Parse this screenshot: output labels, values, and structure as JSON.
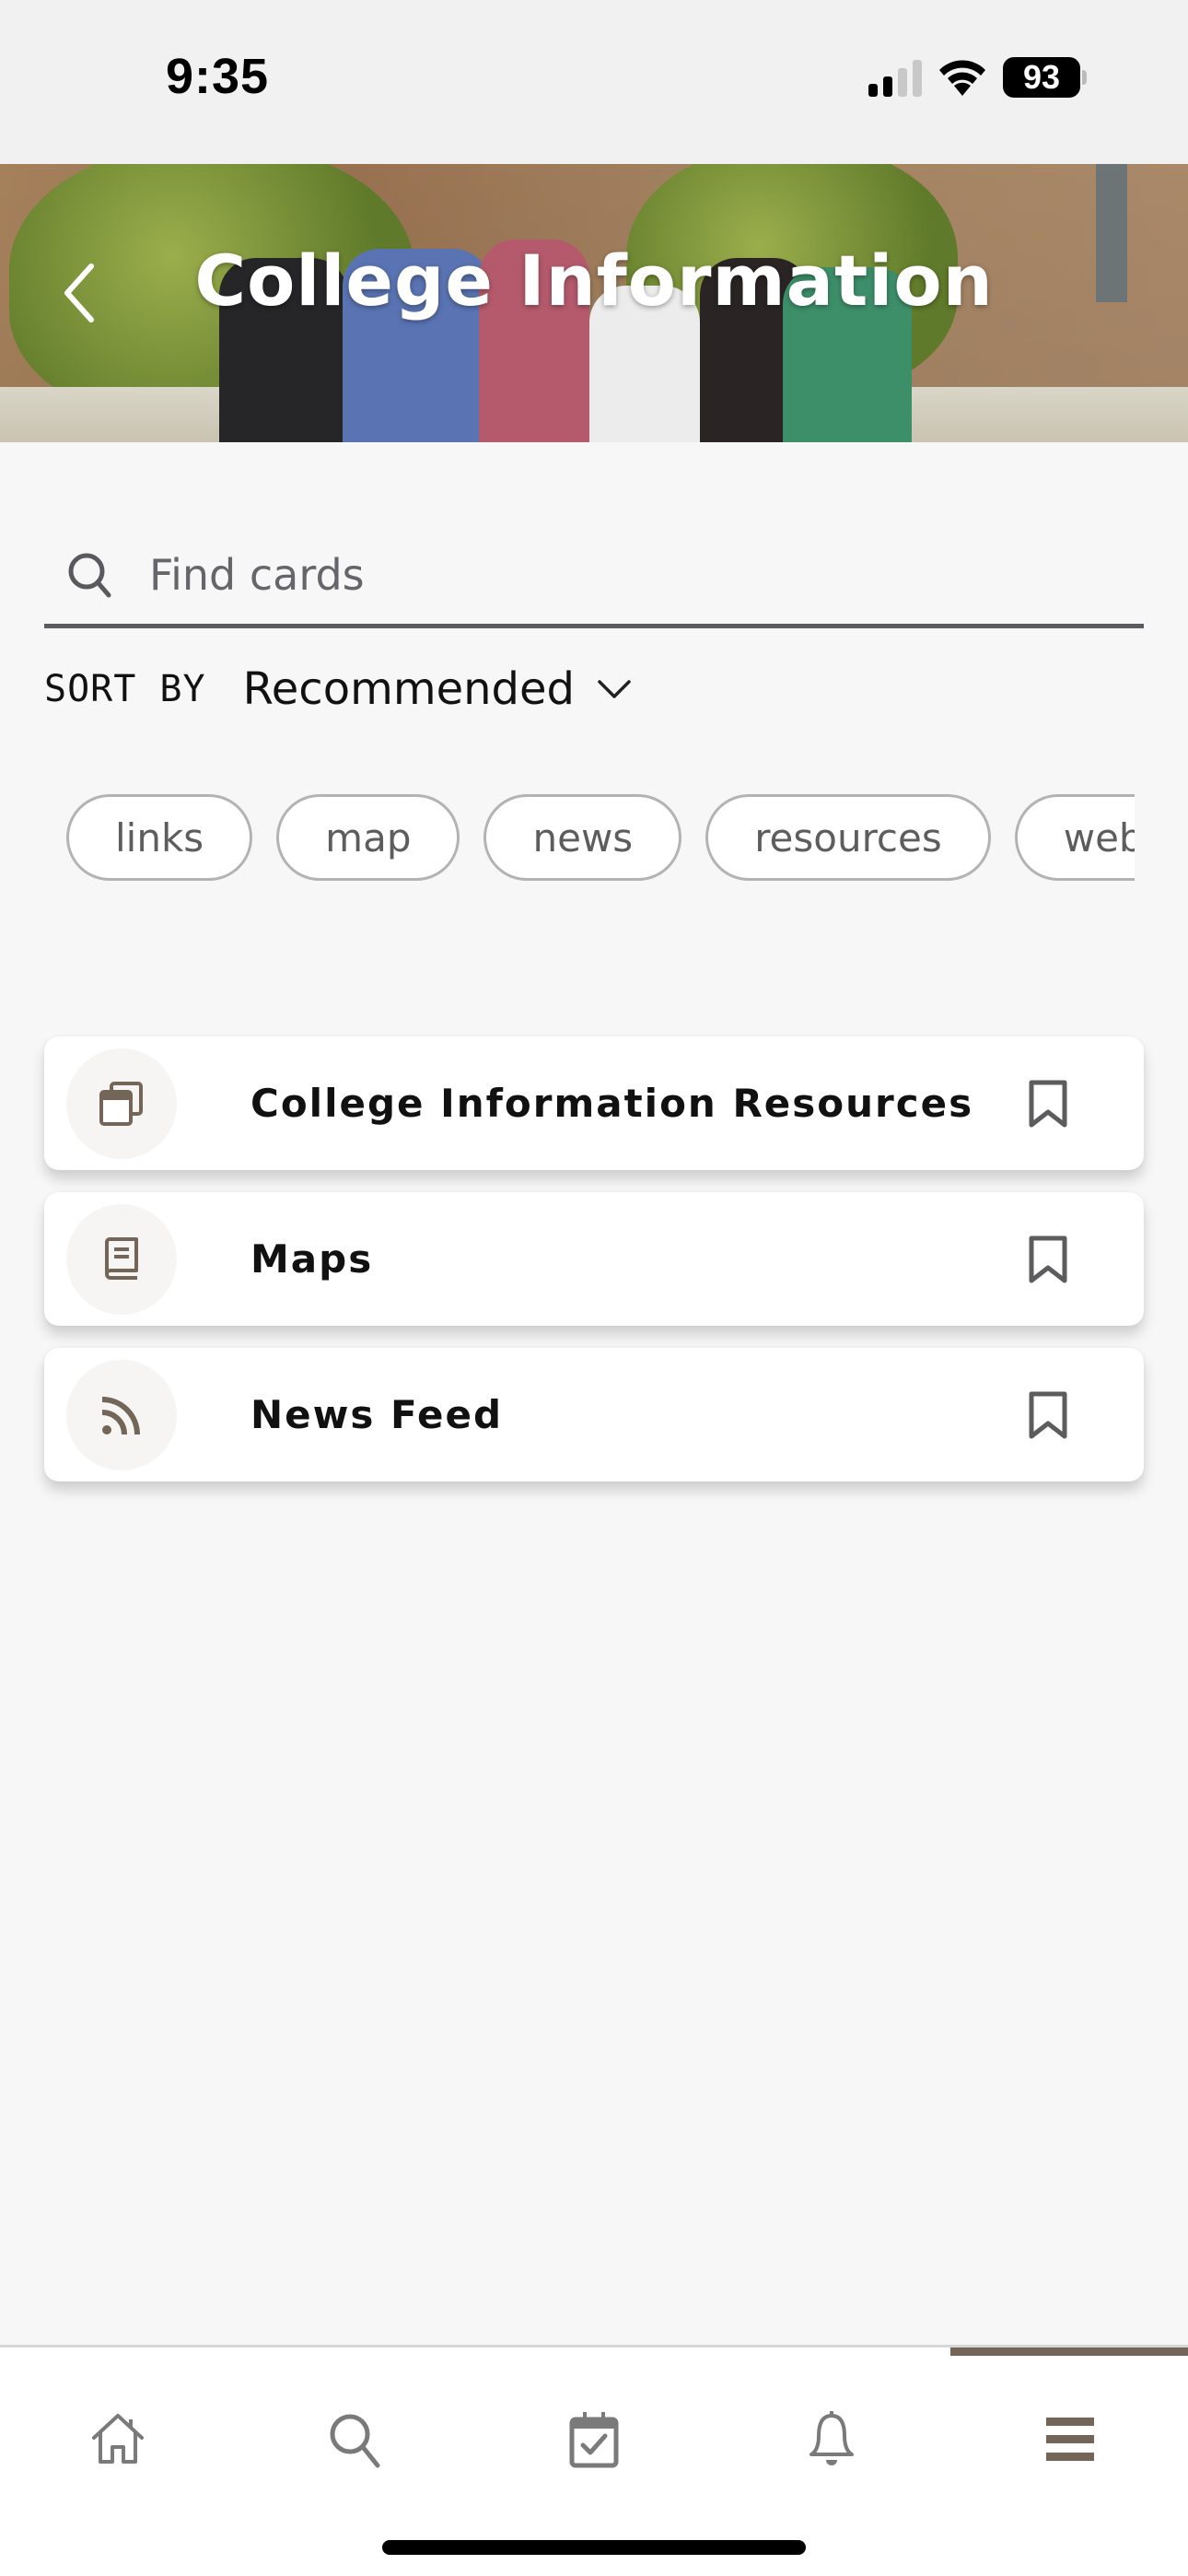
{
  "status_bar": {
    "time": "9:35",
    "battery": "93",
    "signal_bars_active": 2,
    "signal_bars_total": 4
  },
  "header": {
    "title": "College Information",
    "back_icon": "chevron-left-icon"
  },
  "search": {
    "placeholder": "Find cards",
    "value": "",
    "icon": "search-icon"
  },
  "sort": {
    "label": "SORT BY",
    "selected": "Recommended"
  },
  "filters": [
    {
      "label": "links"
    },
    {
      "label": "map"
    },
    {
      "label": "news"
    },
    {
      "label": "resources"
    },
    {
      "label": "web"
    }
  ],
  "cards": [
    {
      "title": "College Information Resources",
      "icon": "windows-icon",
      "bookmarked": false
    },
    {
      "title": "Maps",
      "icon": "book-icon",
      "bookmarked": false
    },
    {
      "title": "News Feed",
      "icon": "rss-icon",
      "bookmarked": false
    }
  ],
  "bottom_nav": {
    "items": [
      {
        "name": "home",
        "icon": "home-icon"
      },
      {
        "name": "search",
        "icon": "search-icon"
      },
      {
        "name": "calendar",
        "icon": "calendar-check-icon"
      },
      {
        "name": "notifications",
        "icon": "bell-icon"
      },
      {
        "name": "menu",
        "icon": "menu-icon",
        "active": true
      }
    ]
  },
  "colors": {
    "accent": "#736659",
    "icon_gray": "#7a7a7a",
    "background": "#f7f7f7"
  }
}
